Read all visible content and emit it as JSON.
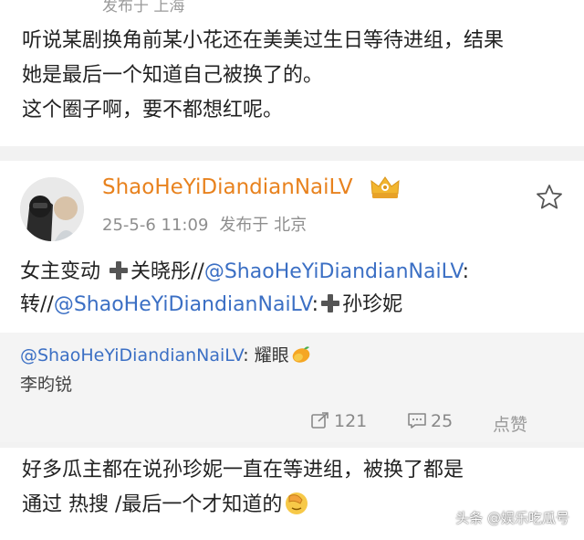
{
  "top_post": {
    "meta": "发布于 上海",
    "text_lines": [
      "听说某剧换角前某小花还在美美过生日等待进组，结果",
      "她是最后一个知道自己被换了的。",
      "这个圈子啊，要不都想红呢。"
    ]
  },
  "post": {
    "username": "ShaoHeYiDiandianNaiLV",
    "date": "25-5-6 11:09",
    "location": "发布于 北京",
    "icons": {
      "avatar": "avatar-photo",
      "badge": "crown-badge-icon",
      "favorite": "star-icon"
    },
    "body": {
      "part1": "女主变动",
      "part2": "关晓彤//",
      "mention1": "@ShaoHeYiDiandianNaiLV",
      "part3": ":",
      "part4": "转//",
      "mention2": "@ShaoHeYiDiandianNaiLV",
      "part5": ":",
      "part6": "孙珍妮"
    },
    "repost": {
      "mention": "@ShaoHeYiDiandianNaiLV",
      "text": ": 耀眼",
      "line2": "李昀锐"
    },
    "actions": {
      "share_count": "121",
      "comment_count": "25",
      "like_label": "点赞"
    }
  },
  "bottom_post": {
    "line1": "好多瓜主都在说孙珍妮一直在等进组，被换了都是",
    "line2": "通过 热搜 /最后一个才知道的"
  },
  "watermark": "头条 @娱乐吃瓜号",
  "colors": {
    "username": "#e8821e",
    "mention": "#3b6fc4",
    "muted": "#8e8e8e",
    "repost_bg": "#f4f4f4"
  }
}
